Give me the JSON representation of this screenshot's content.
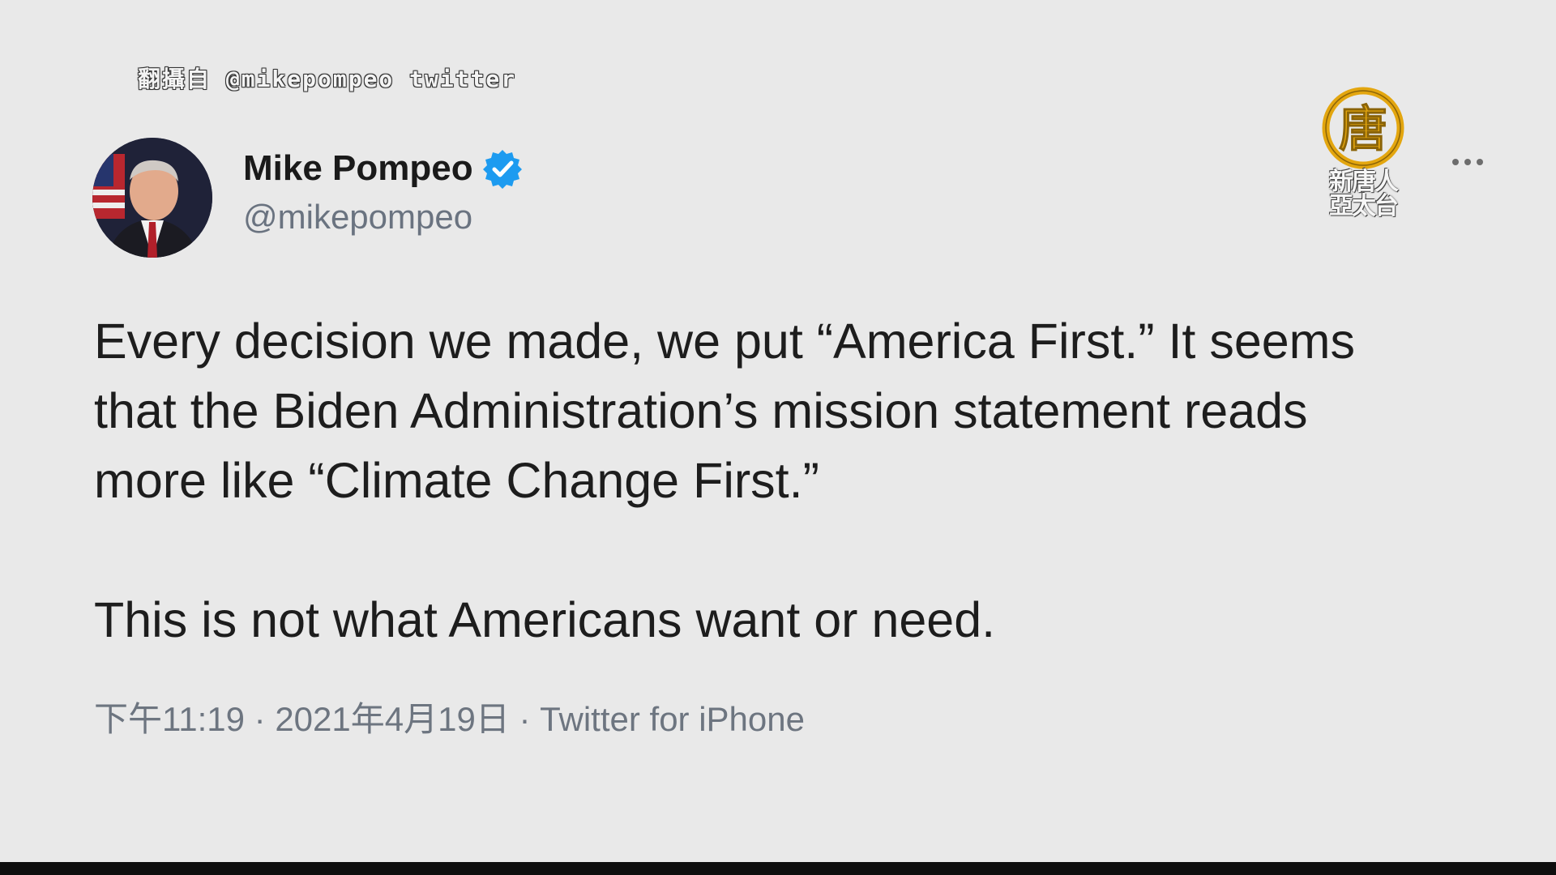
{
  "overlay": {
    "source_caption": "翻攝自 @mikepompeo twitter",
    "logo_text_line1": "新唐人",
    "logo_text_line2": "亞太台",
    "logo_emblem": "唐"
  },
  "tweet": {
    "author": {
      "display_name": "Mike Pompeo",
      "handle": "@mikepompeo",
      "verified": true,
      "avatar_icon": "profile-photo"
    },
    "more_icon": "ellipsis-icon",
    "paragraphs": [
      "Every decision we made, we put “America First.” It seems that the Biden Administration’s mission statement reads more like “Climate Change First.”",
      "This is not what Americans want or need."
    ],
    "meta": {
      "time": "下午11:19",
      "separator1": " · ",
      "date": "2021年4月19日",
      "separator2": " · ",
      "source": "Twitter for iPhone"
    }
  },
  "colors": {
    "background": "#e9e9e9",
    "verified_blue": "#1d9bf0",
    "logo_gold": "#e3a60f",
    "meta_gray": "#6d7580"
  }
}
